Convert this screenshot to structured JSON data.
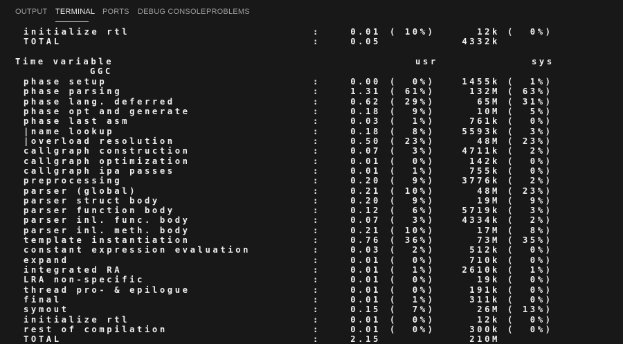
{
  "tabs": [
    {
      "label": "OUTPUT"
    },
    {
      "label": "TERMINAL"
    },
    {
      "label": "PORTS"
    },
    {
      "label": "DEBUG CONSOLE"
    },
    {
      "label": "PROBLEMS"
    }
  ],
  "top_rows": [
    {
      "label": "initialize rtl",
      "colon": ":",
      "usr": "0.01",
      "usr_pct": "( 10%)",
      "mem": "12k",
      "mem_pct": "(  0%)"
    },
    {
      "label": "TOTAL",
      "colon": ":",
      "usr": "0.05",
      "usr_pct": "",
      "mem": "4332k",
      "mem_pct": ""
    }
  ],
  "header": {
    "title": "Time variable",
    "usr": "usr",
    "sys": "sys",
    "group": "GGC"
  },
  "rows": [
    {
      "label": "phase setup",
      "colon": ":",
      "usr": "0.00",
      "usr_pct": "(  0%)",
      "mem": "1455k",
      "mem_pct": "(  1%)"
    },
    {
      "label": "phase parsing",
      "colon": ":",
      "usr": "1.31",
      "usr_pct": "( 61%)",
      "mem": "132M",
      "mem_pct": "( 63%)"
    },
    {
      "label": "phase lang. deferred",
      "colon": ":",
      "usr": "0.62",
      "usr_pct": "( 29%)",
      "mem": "65M",
      "mem_pct": "( 31%)"
    },
    {
      "label": "phase opt and generate",
      "colon": ":",
      "usr": "0.18",
      "usr_pct": "(  9%)",
      "mem": "10M",
      "mem_pct": "(  5%)"
    },
    {
      "label": "phase last asm",
      "colon": ":",
      "usr": "0.03",
      "usr_pct": "(  1%)",
      "mem": "761k",
      "mem_pct": "(  0%)"
    },
    {
      "label": "|name lookup",
      "colon": ":",
      "usr": "0.18",
      "usr_pct": "(  8%)",
      "mem": "5593k",
      "mem_pct": "(  3%)"
    },
    {
      "label": "|overload resolution",
      "colon": ":",
      "usr": "0.50",
      "usr_pct": "( 23%)",
      "mem": "48M",
      "mem_pct": "( 23%)"
    },
    {
      "label": "callgraph construction",
      "colon": ":",
      "usr": "0.07",
      "usr_pct": "(  3%)",
      "mem": "4711k",
      "mem_pct": "(  2%)"
    },
    {
      "label": "callgraph optimization",
      "colon": ":",
      "usr": "0.01",
      "usr_pct": "(  0%)",
      "mem": "142k",
      "mem_pct": "(  0%)"
    },
    {
      "label": "callgraph ipa passes",
      "colon": ":",
      "usr": "0.01",
      "usr_pct": "(  1%)",
      "mem": "755k",
      "mem_pct": "(  0%)"
    },
    {
      "label": "preprocessing",
      "colon": ":",
      "usr": "0.20",
      "usr_pct": "(  9%)",
      "mem": "3776k",
      "mem_pct": "(  2%)"
    },
    {
      "label": "parser (global)",
      "colon": ":",
      "usr": "0.21",
      "usr_pct": "( 10%)",
      "mem": "48M",
      "mem_pct": "( 23%)"
    },
    {
      "label": "parser struct body",
      "colon": ":",
      "usr": "0.20",
      "usr_pct": "(  9%)",
      "mem": "19M",
      "mem_pct": "(  9%)"
    },
    {
      "label": "parser function body",
      "colon": ":",
      "usr": "0.12",
      "usr_pct": "(  6%)",
      "mem": "5719k",
      "mem_pct": "(  3%)"
    },
    {
      "label": "parser inl. func. body",
      "colon": ":",
      "usr": "0.07",
      "usr_pct": "(  3%)",
      "mem": "4334k",
      "mem_pct": "(  2%)"
    },
    {
      "label": "parser inl. meth. body",
      "colon": ":",
      "usr": "0.21",
      "usr_pct": "( 10%)",
      "mem": "17M",
      "mem_pct": "(  8%)"
    },
    {
      "label": "template instantiation",
      "colon": ":",
      "usr": "0.76",
      "usr_pct": "( 36%)",
      "mem": "73M",
      "mem_pct": "( 35%)"
    },
    {
      "label": "constant expression evaluation",
      "colon": ":",
      "usr": "0.03",
      "usr_pct": "(  2%)",
      "mem": "512k",
      "mem_pct": "(  0%)"
    },
    {
      "label": "expand",
      "colon": ":",
      "usr": "0.01",
      "usr_pct": "(  0%)",
      "mem": "710k",
      "mem_pct": "(  0%)"
    },
    {
      "label": "integrated RA",
      "colon": ":",
      "usr": "0.01",
      "usr_pct": "(  1%)",
      "mem": "2610k",
      "mem_pct": "(  1%)"
    },
    {
      "label": "LRA non-specific",
      "colon": ":",
      "usr": "0.01",
      "usr_pct": "(  0%)",
      "mem": "19k",
      "mem_pct": "(  0%)"
    },
    {
      "label": "thread pro- & epilogue",
      "colon": ":",
      "usr": "0.01",
      "usr_pct": "(  0%)",
      "mem": "191k",
      "mem_pct": "(  0%)"
    },
    {
      "label": "final",
      "colon": ":",
      "usr": "0.01",
      "usr_pct": "(  1%)",
      "mem": "311k",
      "mem_pct": "(  0%)"
    },
    {
      "label": "symout",
      "colon": ":",
      "usr": "0.15",
      "usr_pct": "(  7%)",
      "mem": "26M",
      "mem_pct": "( 13%)"
    },
    {
      "label": "initialize rtl",
      "colon": ":",
      "usr": "0.01",
      "usr_pct": "(  0%)",
      "mem": "12k",
      "mem_pct": "(  0%)"
    },
    {
      "label": "rest of compilation",
      "colon": ":",
      "usr": "0.01",
      "usr_pct": "(  0%)",
      "mem": "300k",
      "mem_pct": "(  0%)"
    },
    {
      "label": "TOTAL",
      "colon": ":",
      "usr": "2.15",
      "usr_pct": "",
      "mem": "210M",
      "mem_pct": ""
    }
  ]
}
